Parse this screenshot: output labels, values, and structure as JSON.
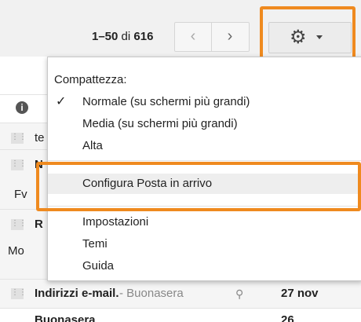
{
  "toolbar": {
    "range": "1–50",
    "of": "di",
    "total": "616",
    "prev_icon": "chevron-left-icon",
    "next_icon": "chevron-right-icon",
    "prev_glyph": "‹",
    "next_glyph": "›",
    "settings_icon": "gear-icon",
    "gear_glyph": "⚙"
  },
  "list": {
    "row1_frag": "te",
    "row2_frag": "N",
    "row2_sub": "F",
    "row2_sub2": "v",
    "row3_frag": "R",
    "row3_sub": "Mo",
    "bottom_subject": "Indirizzi e-mail.",
    "bottom_snippet": "- Buonasera",
    "bottom_date": "27 nov",
    "cut_subject": "Buonasera",
    "cut_date": "26"
  },
  "menu": {
    "heading": "Compattezza:",
    "density_items": [
      {
        "label": "Normale (su schermi più grandi)",
        "checked": true
      },
      {
        "label": "Media (su schermi più grandi)",
        "checked": false
      },
      {
        "label": "Alta",
        "checked": false
      }
    ],
    "configure": "Configura Posta in arrivo",
    "items": [
      {
        "label": "Impostazioni"
      },
      {
        "label": "Temi"
      },
      {
        "label": "Guida"
      }
    ],
    "check_glyph": "✓"
  },
  "colors": {
    "highlight": "#ef8a1f",
    "toolbar_bg": "#f1f1f1"
  }
}
